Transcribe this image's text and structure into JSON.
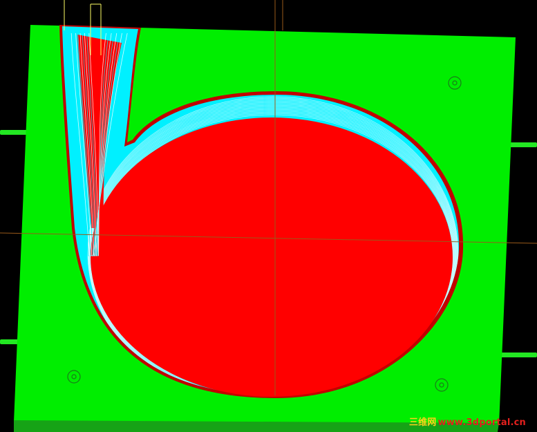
{
  "viewport": {
    "background_color": "#000000",
    "plate_color": "#00ee00",
    "plate_edge_color": "#16a316",
    "pin_color": "#22e722",
    "cavity_color": "#ff0000",
    "cavity_rim_color": "#c10000",
    "toolpath_color": "#00f0ff",
    "toolpath_line_color": "#ffffff",
    "crosshair_color": "#9a5a1a",
    "tube_color": "#ffff66",
    "hole_icon": "mounting-hole-icon"
  },
  "watermark": {
    "site_name": "三维网",
    "url": "www.3dportal.cn"
  }
}
